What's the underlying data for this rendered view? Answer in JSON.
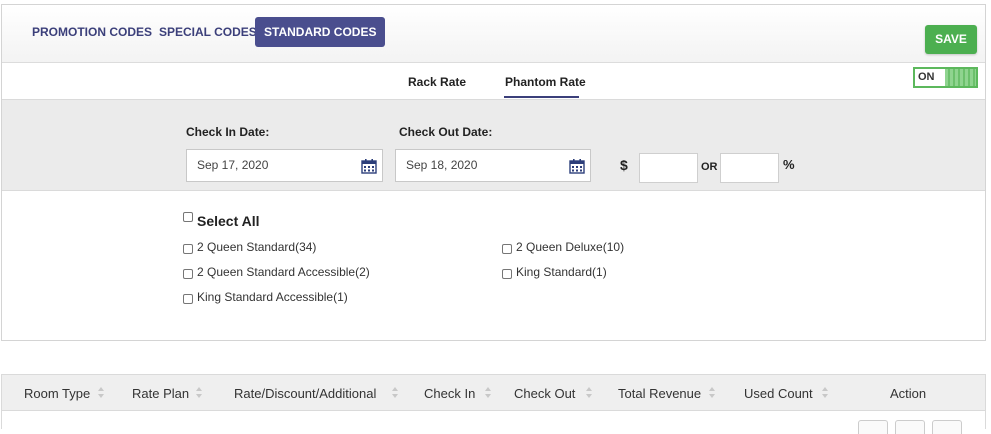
{
  "top_tabs": [
    {
      "label": "PROMOTION CODES",
      "active": false
    },
    {
      "label": "SPECIAL CODES",
      "active": false
    },
    {
      "label": "STANDARD CODES",
      "active": true
    }
  ],
  "save_label": "SAVE",
  "sub_tabs": [
    {
      "label": "Rack Rate",
      "active": false
    },
    {
      "label": "Phantom Rate",
      "active": true
    }
  ],
  "toggle": {
    "label": "ON",
    "state": true
  },
  "dates": {
    "check_in_label": "Check In Date:",
    "check_in_value": "Sep 17, 2020",
    "check_out_label": "Check Out Date:",
    "check_out_value": "Sep 18, 2020"
  },
  "amount": {
    "currency_symbol": "$",
    "or_label": "OR",
    "percent_symbol": "%",
    "amount_value": "",
    "percent_value": ""
  },
  "rooms": {
    "select_all_label": "Select All",
    "items": [
      {
        "label": "2 Queen Standard(34)",
        "checked": false
      },
      {
        "label": "2 Queen Deluxe(10)",
        "checked": false
      },
      {
        "label": "2 Queen Standard Accessible(2)",
        "checked": false
      },
      {
        "label": "King Standard(1)",
        "checked": false
      },
      {
        "label": "King Standard Accessible(1)",
        "checked": false
      }
    ]
  },
  "table": {
    "columns": [
      "Room Type",
      "Rate Plan",
      "Rate/Discount/Additional",
      "Check In",
      "Check Out",
      "Total Revenue",
      "Used Count",
      "Action"
    ]
  },
  "colors": {
    "accent": "#4a4e8e",
    "save": "#4caf50",
    "toggle_on": "#5cb85c"
  },
  "icons": [
    "calendar-icon",
    "sort-icon"
  ]
}
